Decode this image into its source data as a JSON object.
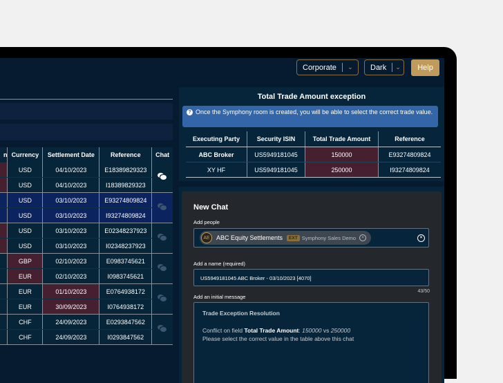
{
  "topbar": {
    "theme_select": "Corporate",
    "mode_select": "Dark",
    "help_label": "Help"
  },
  "main_table": {
    "columns": [
      "n",
      "Currency",
      "Settlement Date",
      "Reference",
      "Chat"
    ],
    "groups": [
      {
        "rows": [
          {
            "currency": "USD",
            "date": "04/10/2023",
            "reference": "E18389829323"
          },
          {
            "currency": "USD",
            "date": "04/10/2023",
            "reference": "I18389829323"
          }
        ],
        "chat_active": true
      },
      {
        "rows": [
          {
            "currency": "USD",
            "date": "03/10/2023",
            "reference": "E93274809824"
          },
          {
            "currency": "USD",
            "date": "03/10/2023",
            "reference": "I93274809824"
          }
        ],
        "chat_active": false,
        "highlighted": true
      },
      {
        "rows": [
          {
            "currency": "USD",
            "date": "03/10/2023",
            "reference": "E02348237923"
          },
          {
            "currency": "USD",
            "date": "03/10/2023",
            "reference": "I02348237923"
          }
        ],
        "chat_active": false
      },
      {
        "rows": [
          {
            "currency": "GBP",
            "date": "02/10/2023",
            "reference": "E0983745621"
          },
          {
            "currency": "EUR",
            "date": "02/10/2023",
            "reference": "I0983745621"
          }
        ],
        "chat_active": false
      },
      {
        "rows": [
          {
            "currency": "EUR",
            "date": "01/10/2023",
            "reference": "E0764938172"
          },
          {
            "currency": "EUR",
            "date": "30/09/2023",
            "reference": "I0764938172"
          }
        ],
        "chat_active": false
      },
      {
        "rows": [
          {
            "currency": "CHF",
            "date": "24/09/2023",
            "reference": "E0293847562"
          },
          {
            "currency": "CHF",
            "date": "24/09/2023",
            "reference": "I0293847562"
          }
        ],
        "chat_active": false
      }
    ]
  },
  "exception": {
    "title": "Total Trade Amount exception",
    "info": "Once the Symphony room is created, you will be able to select the correct trade value.",
    "columns": [
      "Executing Party",
      "Security ISIN",
      "Total Trade Amount",
      "Reference"
    ],
    "rows": [
      {
        "party": "ABC Broker",
        "isin": "US5949181045",
        "amount": "150000",
        "reference": "E93274809824"
      },
      {
        "party": "XY HF",
        "isin": "US5949181045",
        "amount": "250000",
        "reference": "I93274809824"
      }
    ]
  },
  "new_chat": {
    "title": "New Chat",
    "people_label": "Add people",
    "person": {
      "initials": "AE",
      "name": "ABC Equity Settlements",
      "badge": "EXT",
      "org": "Symphony Sales Demo"
    },
    "name_label": "Add a name (required)",
    "name_value": "US5949181045 ABC Broker - 03/10/2023 [4070]",
    "counter": "43/50",
    "message_label": "Add an initial message",
    "message": {
      "title": "Trade Exception Resolution",
      "line1_prefix": "Conflict on field ",
      "line1_field": "Total Trade Amount",
      "line1_colon": ": ",
      "value_a": "150000",
      "vs": " vs ",
      "value_b": "250000",
      "line2": "Please select the correct value in the table above this chat"
    }
  }
}
